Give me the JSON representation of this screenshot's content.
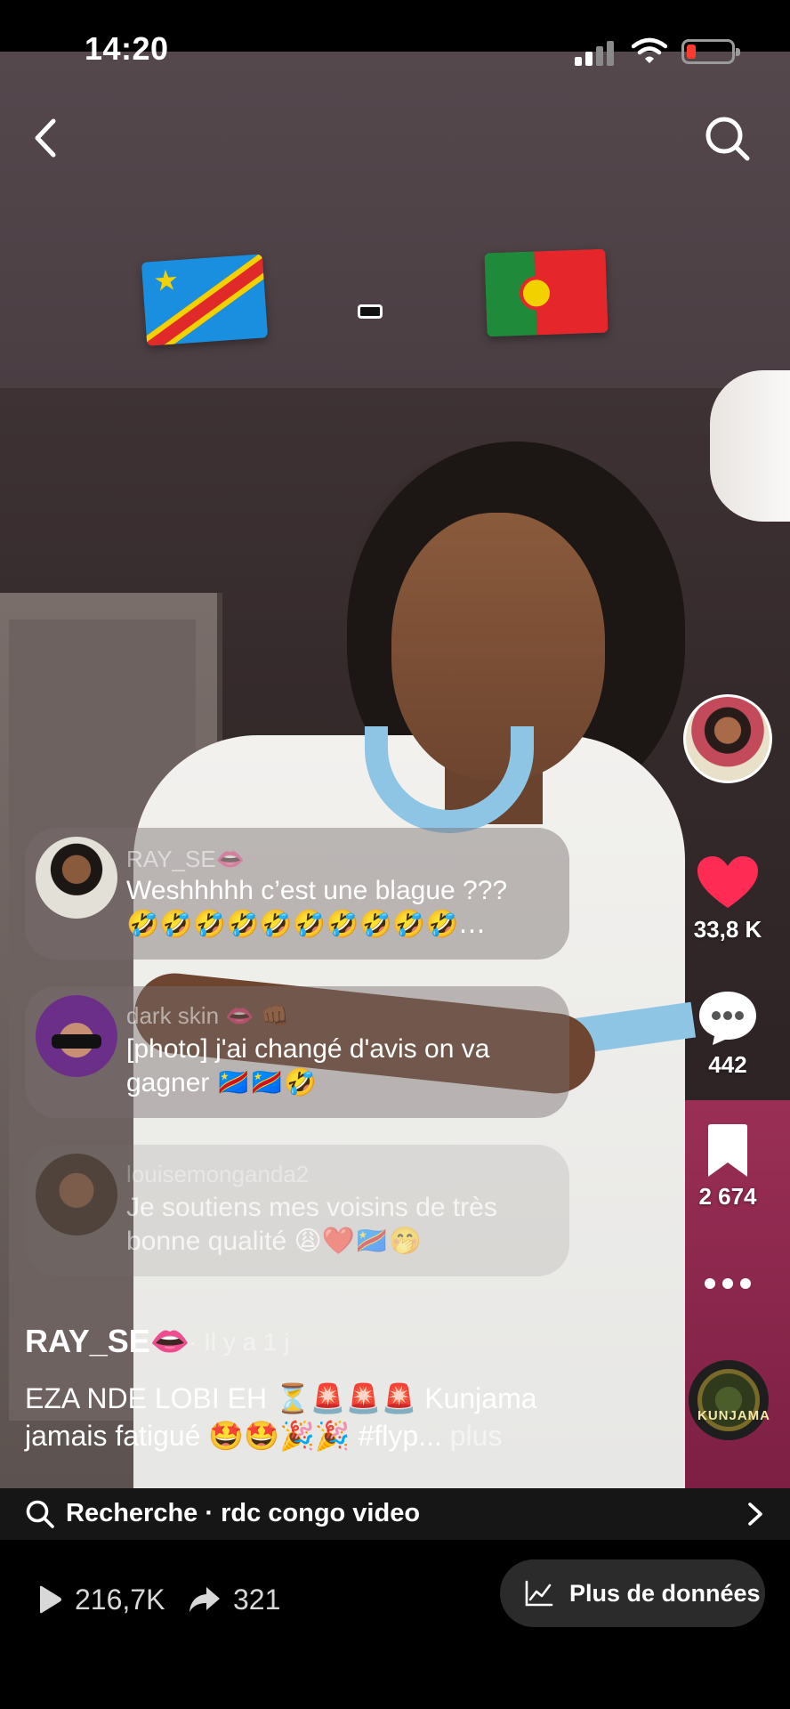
{
  "status_bar": {
    "time": "14:20"
  },
  "nav": {
    "back_icon": "chevron-left-icon",
    "search_icon": "search-icon"
  },
  "overlay": {
    "flags": [
      "DR Congo flag",
      "Portugal flag"
    ],
    "separator": "-"
  },
  "rail": {
    "likes": "33,8 K",
    "comments": "442",
    "saves": "2 674",
    "more_icon": "ellipsis-icon",
    "music_label": "KUNJAMA"
  },
  "comments": [
    {
      "user": "RAY_SE👄",
      "text": "Weshhhhh c’est une blague ???",
      "emojis": "🤣🤣🤣🤣🤣🤣🤣🤣🤣🤣…"
    },
    {
      "user": "dark skin 👄 👊🏾",
      "text": "[photo] j'ai changé d'avis on va gagner 🇨🇩🇨🇩🤣"
    },
    {
      "user": "louisemonganda2",
      "text": "Je soutiens mes voisins de très bonne qualité 😩❤️🇨🇩🤭"
    }
  ],
  "caption": {
    "username": "RAY_SE👄",
    "time": "· Il y a 1 j",
    "text": "EZA NDE LOBI EH ⏳🚨🚨🚨 Kunjama jamais fatigué 🤩🤩🎉🎉 #flyp...",
    "more": "plus"
  },
  "search_bar": {
    "text": "Recherche · rdc congo video"
  },
  "bottom": {
    "views": "216,7K",
    "shares": "321",
    "more_data_label": "Plus de données"
  },
  "colors": {
    "like": "#fe2c55",
    "bottom_bg": "#000000",
    "button_bg": "#2b2b2b"
  }
}
